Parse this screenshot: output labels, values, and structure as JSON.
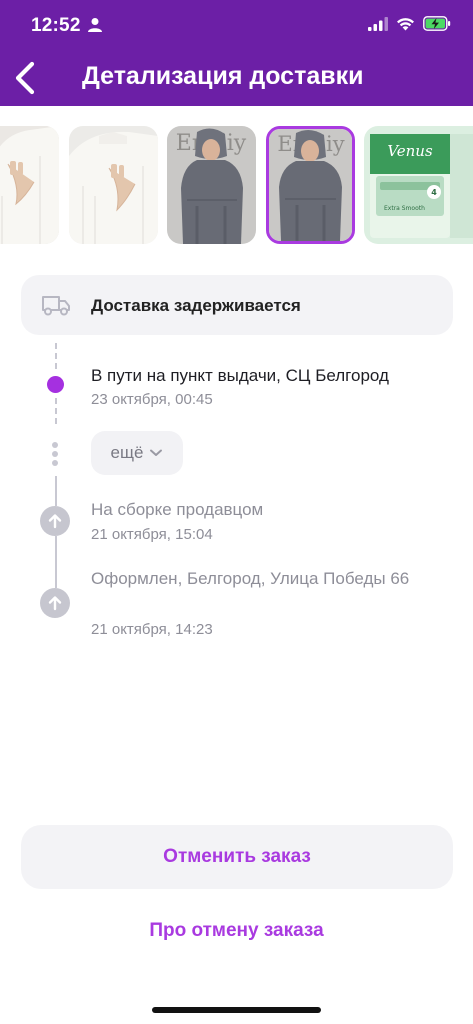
{
  "status_bar": {
    "time": "12:52"
  },
  "header": {
    "title": "Детализация доставки"
  },
  "thumbnails": [
    {
      "name": "white-sweater-1",
      "bg": "#e9e6e3"
    },
    {
      "name": "white-sweater-2",
      "bg": "#ecebe8"
    },
    {
      "name": "grey-tracksuit-1",
      "bg": "#8a8c93"
    },
    {
      "name": "grey-tracksuit-2",
      "bg": "#8a8c93",
      "selected": true
    },
    {
      "name": "venus-razor",
      "bg": "#dff0e3"
    }
  ],
  "thumbnail_texts": {
    "brand_1": "Emiliy",
    "brand_2": "Emiliy",
    "venus_brand": "Venus",
    "venus_sub": "Extra Smooth",
    "venus_count": "4"
  },
  "delivery": {
    "status": "Доставка задерживается"
  },
  "timeline": {
    "events": [
      {
        "title": "В пути на пункт выдачи, СЦ Белгород",
        "date": "23 октября, 00:45",
        "active": true
      },
      {
        "title": "На сборке продавцом",
        "date": "21 октября, 15:04",
        "active": false
      },
      {
        "title": "Оформлен, Белгород, Улица Победы 66",
        "date": "21 октября, 14:23",
        "active": false
      }
    ],
    "more_label": "ещё"
  },
  "actions": {
    "cancel_label": "Отменить заказ",
    "about_cancel_label": "Про отмену заказа"
  },
  "colors": {
    "header_bg": "#6c1fa6",
    "accent": "#a93ae0",
    "muted": "#8e8e98"
  }
}
